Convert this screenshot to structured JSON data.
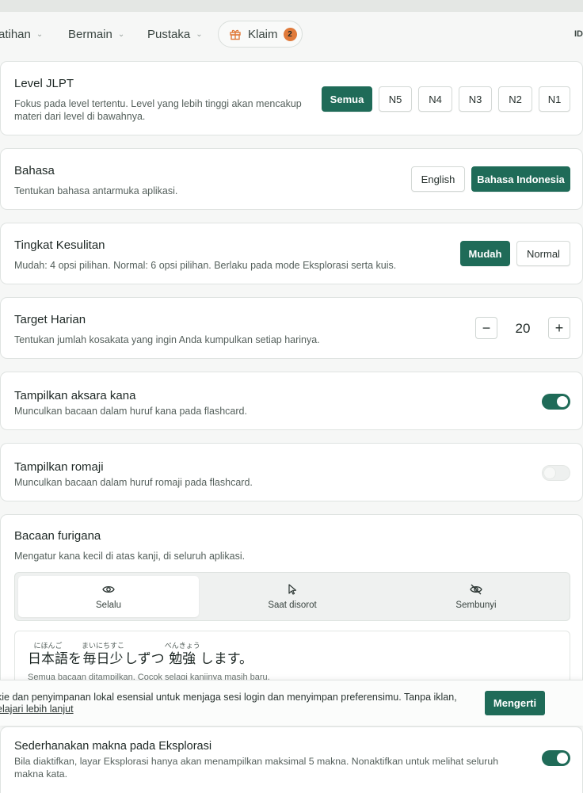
{
  "nav": {
    "items": [
      {
        "label": "atihan"
      },
      {
        "label": "Bermain"
      },
      {
        "label": "Pustaka"
      }
    ],
    "claim_label": "Klaim",
    "claim_count": "2",
    "lang_abbrev": "ID"
  },
  "jlpt": {
    "title": "Level JLPT",
    "desc_line1": "Fokus pada level tertentu. Level yang lebih tinggi akan mencakup",
    "desc_line2": "materi dari level di bawahnya.",
    "options": [
      "Semua",
      "N5",
      "N4",
      "N3",
      "N2",
      "N1"
    ],
    "selected": "Semua"
  },
  "language": {
    "title": "Bahasa",
    "desc": "Tentukan bahasa antarmuka aplikasi.",
    "options": [
      "English",
      "Bahasa Indonesia"
    ],
    "selected": "Bahasa Indonesia"
  },
  "difficulty": {
    "title": "Tingkat Kesulitan",
    "desc": "Mudah: 4 opsi pilihan. Normal: 6 opsi pilihan. Berlaku pada mode Eksplorasi serta kuis.",
    "options": [
      "Mudah",
      "Normal"
    ],
    "selected": "Mudah"
  },
  "daily_target": {
    "title": "Target Harian",
    "desc": "Tentukan jumlah kosakata yang ingin Anda kumpulkan setiap harinya.",
    "value": "20",
    "minus": "−",
    "plus": "+"
  },
  "show_kana": {
    "title": "Tampilkan aksara kana",
    "desc": "Munculkan bacaan dalam huruf kana pada flashcard.",
    "enabled": true
  },
  "show_romaji": {
    "title": "Tampilkan romaji",
    "desc": "Munculkan bacaan dalam huruf romaji pada flashcard.",
    "enabled": false
  },
  "furigana": {
    "title": "Bacaan furigana",
    "desc": "Mengatur kana kecil di atas kanji, di seluruh aplikasi.",
    "options": [
      {
        "label": "Selalu",
        "icon": "eye-icon"
      },
      {
        "label": "Saat disorot",
        "icon": "cursor-icon"
      },
      {
        "label": "Sembunyi",
        "icon": "eye-off-icon"
      }
    ],
    "selected": "Selalu",
    "preview": {
      "word1": "日本語",
      "ruby1": "にほんご",
      "particle": "を",
      "word2": "毎日",
      "ruby2": "まいにちすこ",
      "word3": "少",
      "rest1": "しずつ",
      "word4": "勉強",
      "ruby4": "べんきょう",
      "rest2": "します。",
      "note": "Semua bacaan ditampilkan. Cocok selagi kanjinya masih baru."
    }
  },
  "cookie": {
    "text": "kie dan penyimpanan lokal esensial untuk menjaga sesi login dan menyimpan preferensimu. Tanpa iklan,",
    "link": "elajari lebih lanjut",
    "button": "Mengerti"
  },
  "simplify": {
    "title": "Sederhanakan makna pada Eksplorasi",
    "desc_line1": "Bila diaktifkan, layar Eksplorasi hanya akan menampilkan maksimal 5 makna. Nonaktifkan untuk melihat seluruh",
    "desc_line2": "makna kata.",
    "enabled": true
  },
  "colors": {
    "accent": "#1f6b58",
    "badge": "#e07a3a"
  }
}
